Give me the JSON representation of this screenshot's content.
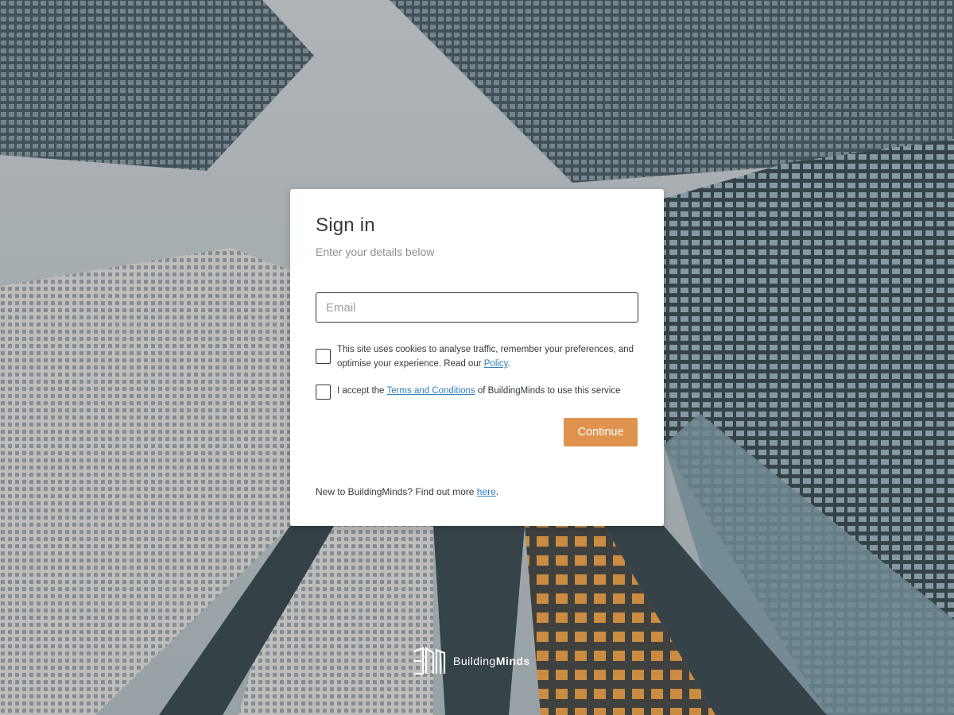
{
  "signin": {
    "title": "Sign in",
    "subtitle": "Enter your details below",
    "email_placeholder": "Email",
    "cookies_text_before": "This site uses cookies to analyse traffic, remember your preferences, and optimise your experience. Read our ",
    "cookies_link": "Policy",
    "cookies_text_after": ".",
    "terms_text_before": "I accept the ",
    "terms_link": "Terms and Conditions",
    "terms_text_after": " of BuildingMinds to use this service",
    "continue_label": "Continue",
    "footer_text_before": "New to BuildingMinds? Find out more ",
    "footer_link": "here",
    "footer_text_after": "."
  },
  "brand": {
    "name_part1": "Building",
    "name_part2": "Minds",
    "logo_icon": "buildingminds-logo-icon"
  },
  "colors": {
    "accent": "#e0924f",
    "link": "#2f7fbf",
    "text": "#333a3f"
  }
}
